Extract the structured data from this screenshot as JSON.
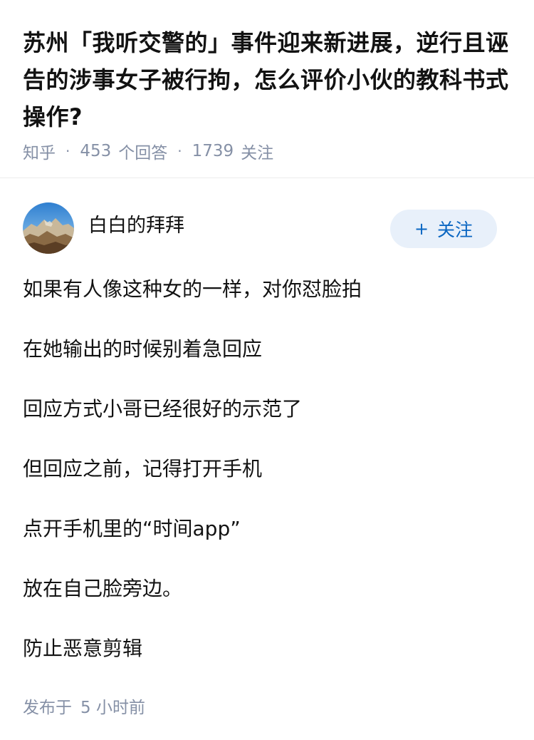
{
  "question": {
    "title": "苏州「我听交警的」事件迎来新进展，逆行且诬告的涉事女子被行拘，怎么评价小伙的教科书式操作?",
    "source": "知乎",
    "separator": "·",
    "answer_count": "453",
    "answer_label": "个回答",
    "follower_count": "1739",
    "follower_label": "关注"
  },
  "answer": {
    "author": {
      "name": "白白的拜拜",
      "avatar_icon": "mountain-landscape-avatar"
    },
    "follow_button": {
      "plus": "+",
      "label": "关注"
    },
    "paragraphs": [
      "如果有人像这种女的一样，对你怼脸拍",
      "在她输出的时候别着急回应",
      "回应方式小哥已经很好的示范了",
      "但回应之前，记得打开手机",
      "点开手机里的“时间app”",
      "放在自己脸旁边。",
      "防止恶意剪辑"
    ],
    "published_label": "发布于",
    "published_time": "5 小时前"
  },
  "colors": {
    "title": "#121212",
    "meta": "#8590a6",
    "follow_bg": "#e8f0fa",
    "follow_text": "#0a66c2",
    "divider": "#ececec"
  }
}
